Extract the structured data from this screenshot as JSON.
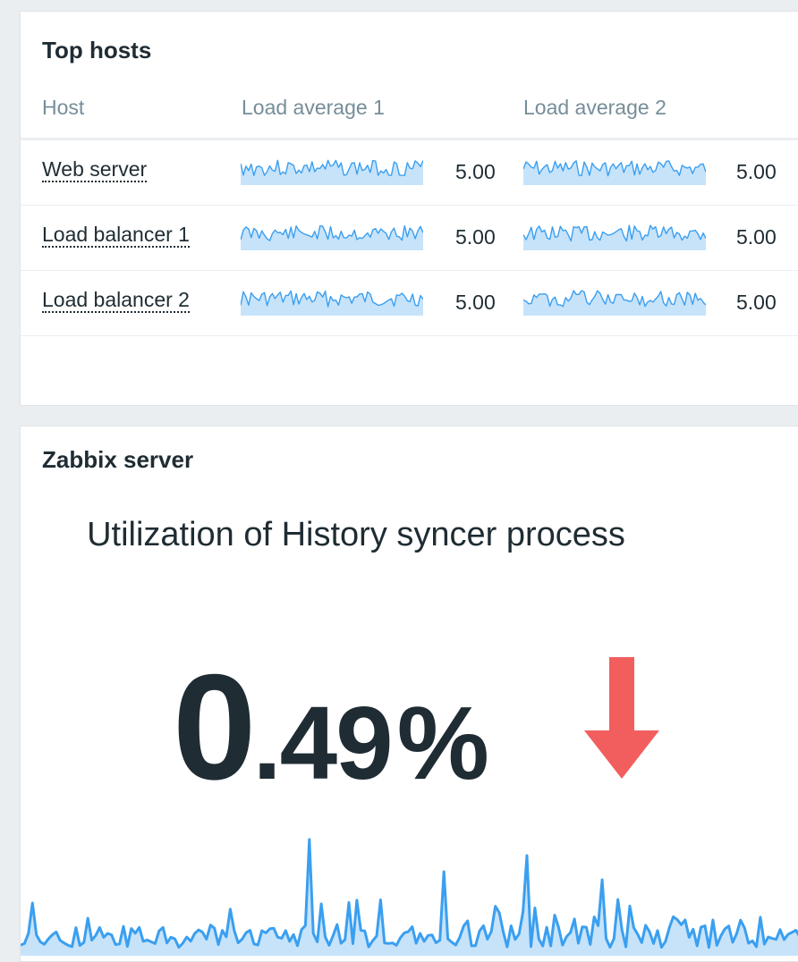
{
  "top_hosts": {
    "title": "Top hosts",
    "columns": [
      "Host",
      "Load average 1",
      "Load average 2"
    ],
    "rows": [
      {
        "host": "Web server",
        "load1": "5.00",
        "load2": "5.00"
      },
      {
        "host": "Load balancer 1",
        "load1": "5.00",
        "load2": "5.00"
      },
      {
        "host": "Load balancer 2",
        "load1": "5.00",
        "load2": "5.00"
      }
    ]
  },
  "item_value": {
    "title": "Zabbix server",
    "description": "Utilization of History syncer process",
    "value_int": "0",
    "value_dec": ".49",
    "unit": "%",
    "trend": "down-arrow-icon"
  },
  "colors": {
    "sparkline_line": "#3a9ff0",
    "sparkline_fill": "#c7e3fa",
    "trend_down": "#f25e5e",
    "text": "#1f2c33",
    "header_text": "#768d99"
  }
}
